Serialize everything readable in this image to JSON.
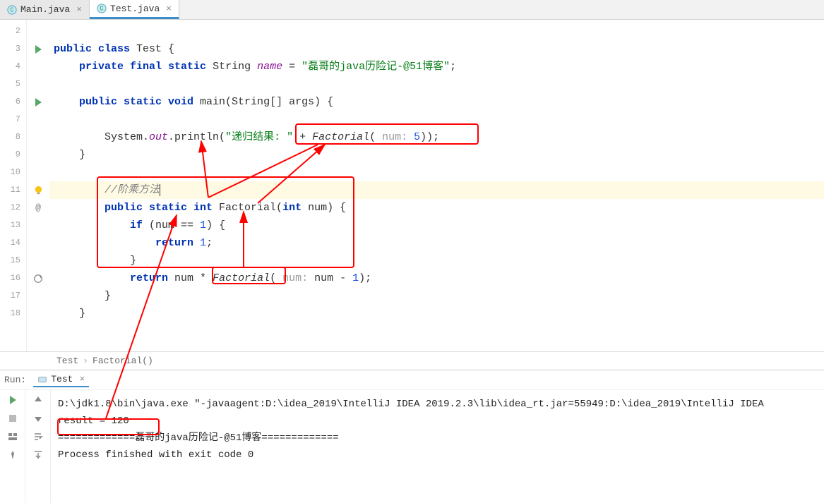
{
  "tabs": [
    {
      "label": "Main.java",
      "active": false
    },
    {
      "label": "Test.java",
      "active": true
    }
  ],
  "lines": {
    "start": 2,
    "end": 18
  },
  "code": {
    "l3": {
      "kw1": "public class",
      "name": "Test {"
    },
    "l4": {
      "kw": "private final static",
      "type": "String",
      "fld": "name",
      "eq": " = ",
      "str": "\"磊哥的java历险记-@51博客\"",
      "end": ";"
    },
    "l6": {
      "kw": "public static void",
      "m": " main(String[] args) {"
    },
    "l8": {
      "pre": "System.",
      "out": "out",
      "mid": ".println(",
      "str": "\"递归结果: \"",
      "plus": " + ",
      "fn": "Factorial",
      "paren": "( ",
      "hint": "num:",
      "num": " 5",
      "end": "));"
    },
    "l9": "}",
    "l11": "//阶乘方法",
    "l12": {
      "kw": "public static int",
      "m": " Factorial(",
      "kw2": "int",
      "rest": " num) {"
    },
    "l13": {
      "kw": "if",
      "rest": " (num == ",
      "num": "1",
      "end": ") {"
    },
    "l14": {
      "kw": "return",
      "num": " 1",
      "end": ";"
    },
    "l15": "}",
    "l16": {
      "kw": "return",
      "rest": " num * ",
      "fn": "Factorial",
      "paren": "( ",
      "hint": "num:",
      "rest2": " num - ",
      "num": "1",
      "end": ");"
    },
    "l17": "}",
    "l18": "}"
  },
  "breadcrumb": {
    "a": "Test",
    "b": "Factorial()"
  },
  "run": {
    "label": "Run:",
    "tab": "Test",
    "line1": "D:\\jdk1.8\\bin\\java.exe \"-javaagent:D:\\idea_2019\\IntelliJ IDEA 2019.2.3\\lib\\idea_rt.jar=55949:D:\\idea_2019\\IntelliJ IDEA",
    "line2": "result = 120",
    "line3": "=============磊哥的java历险记-@51博客=============",
    "line4": "",
    "line5": "Process finished with exit code 0"
  }
}
